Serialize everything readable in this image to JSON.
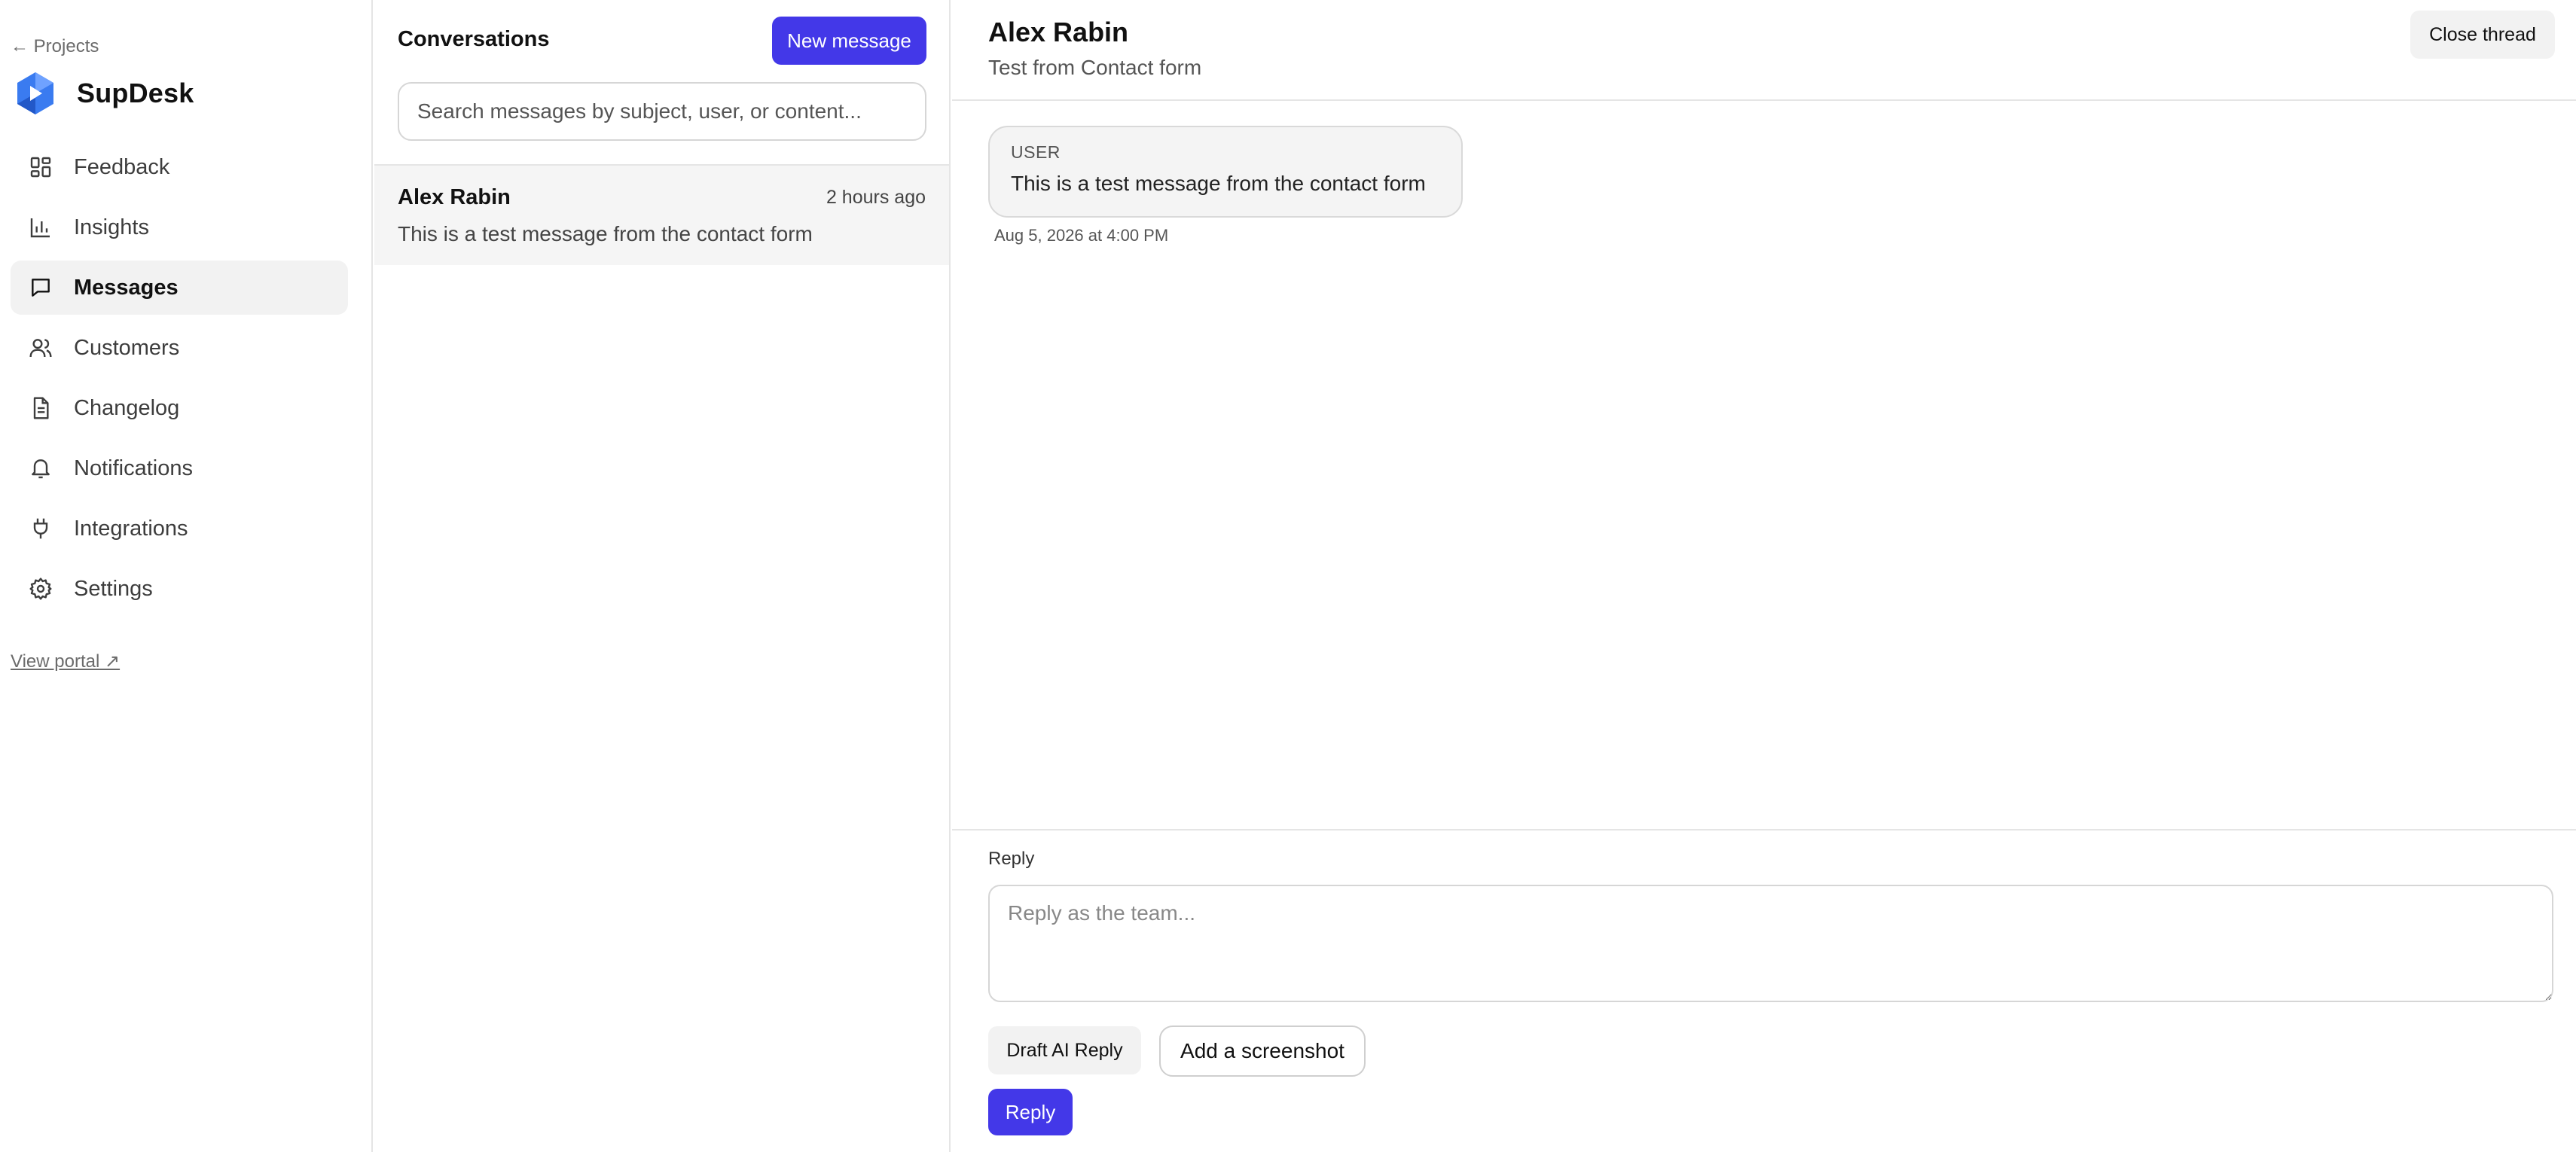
{
  "sidebar": {
    "back_label": "← Projects",
    "brand_name": "SupDesk",
    "items": [
      {
        "label": "Feedback",
        "icon": "grid-icon"
      },
      {
        "label": "Insights",
        "icon": "bar-chart-icon"
      },
      {
        "label": "Messages",
        "icon": "message-square-icon",
        "active": true
      },
      {
        "label": "Customers",
        "icon": "users-icon"
      },
      {
        "label": "Changelog",
        "icon": "file-text-icon"
      },
      {
        "label": "Notifications",
        "icon": "bell-icon"
      },
      {
        "label": "Integrations",
        "icon": "plug-icon"
      },
      {
        "label": "Settings",
        "icon": "gear-icon"
      }
    ],
    "view_portal": "View portal ↗"
  },
  "conversations": {
    "title": "Conversations",
    "new_button": "New message",
    "search_placeholder": "Search messages by subject, user, or content...",
    "items": [
      {
        "name": "Alex Rabin",
        "time": "2 hours ago",
        "preview": "This is a test message from the contact form"
      }
    ]
  },
  "thread": {
    "name": "Alex Rabin",
    "subject": "Test from Contact form",
    "close_button": "Close thread",
    "messages": [
      {
        "role": "USER",
        "text": "This is a test message from the contact form",
        "time": "Aug 5, 2026 at 4:00 PM"
      }
    ],
    "reply": {
      "label": "Reply",
      "placeholder": "Reply as the team...",
      "draft_ai_button": "Draft AI Reply",
      "screenshot_button": "Add a screenshot",
      "send_button": "Reply"
    }
  },
  "colors": {
    "accent": "#4338e8",
    "active_bg": "#f2f2f2",
    "border": "#e5e5e5"
  }
}
